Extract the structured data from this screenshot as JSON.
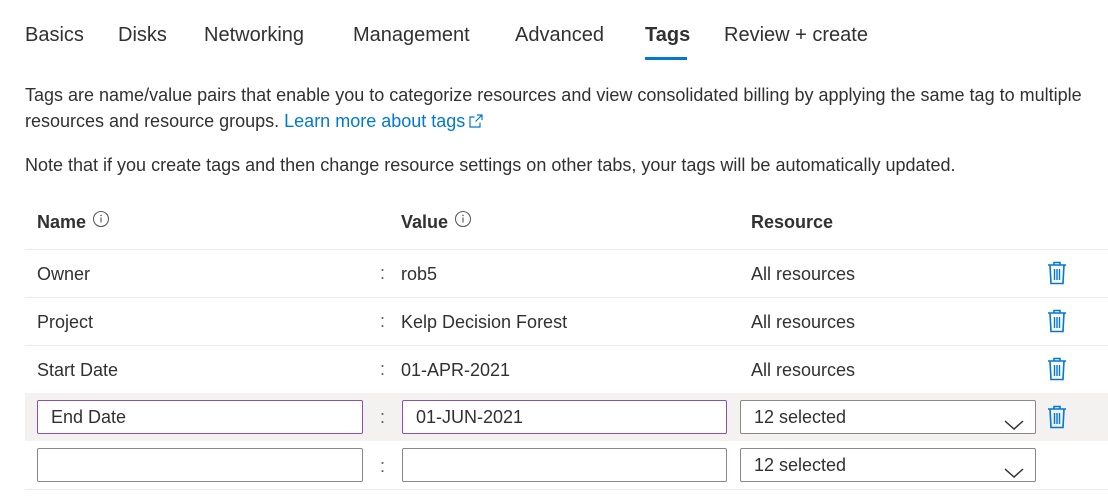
{
  "tabs": [
    {
      "label": "Basics"
    },
    {
      "label": "Disks"
    },
    {
      "label": "Networking"
    },
    {
      "label": "Management"
    },
    {
      "label": "Advanced"
    },
    {
      "label": "Tags",
      "active": true
    },
    {
      "label": "Review + create"
    }
  ],
  "description": {
    "text": "Tags are name/value pairs that enable you to categorize resources and view consolidated billing by applying the same tag to multiple resources and resource groups.",
    "link_label": "Learn more about tags",
    "link_icon": "external-link-icon"
  },
  "note": "Note that if you create tags and then change resource settings on other tabs, your tags will be automatically updated.",
  "table": {
    "headers": {
      "name": "Name",
      "value": "Value",
      "resource": "Resource"
    },
    "header_icon": "info-icon",
    "separator": ":",
    "rows": [
      {
        "name": "Owner",
        "value": "rob5",
        "resource": "All resources"
      },
      {
        "name": "Project",
        "value": "Kelp Decision Forest",
        "resource": "All resources"
      },
      {
        "name": "Start Date",
        "value": "01-APR-2021",
        "resource": "All resources"
      }
    ],
    "edit_row": {
      "name": "End Date",
      "value": "01-JUN-2021",
      "resource": "12 selected"
    },
    "new_row": {
      "name": "",
      "value": "",
      "resource": "12 selected"
    },
    "delete_icon": "trash-icon",
    "dropdown_icon": "chevron-down-icon"
  },
  "colors": {
    "accent": "#0078d4",
    "focus_border": "#8a4fb8",
    "row_highlight": "#f3f2f1",
    "text": "#323130"
  }
}
